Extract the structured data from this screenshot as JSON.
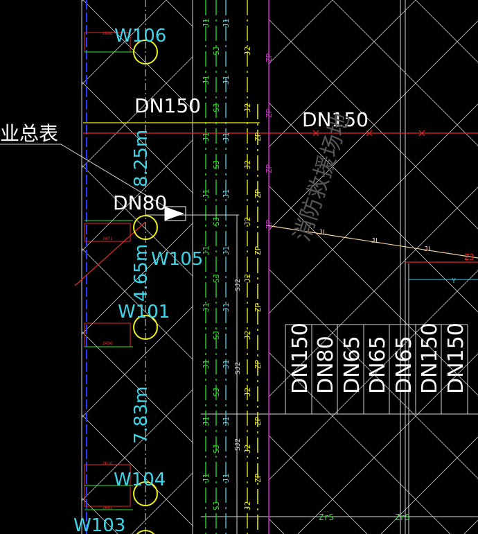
{
  "labels": {
    "meter_label": "业总表",
    "site_label": "消防救援场地",
    "dn150_top": "DN150",
    "dn150_main": "DN150",
    "dn80": "DN80",
    "dim_1": "8.25m",
    "dim_2": "4.65m",
    "dim_3": "7.83m",
    "well_w106": "W106",
    "well_w105": "W105",
    "well_w101": "W101",
    "well_w104": "W104",
    "well_w103": "W103",
    "zrs_1": "ZrS",
    "zrs_2": "ZrS",
    "z3": "Z3"
  },
  "pipe_codes": {
    "j1": "J1",
    "sj": "SJ",
    "j2": "J2",
    "zp": "ZP",
    "sj2": "SJ2",
    "jl": "JL",
    "x": "X",
    "y": "Y"
  },
  "pipe_table": [
    "DN150",
    "DN80",
    "DN65",
    "DN65",
    "DN65",
    "DN150",
    "DN150"
  ],
  "small_dims": [
    "2696",
    "2471",
    "2496",
    "2616",
    "2681"
  ],
  "colors": {
    "background": "#000000",
    "grid_white": "#d8d8d8",
    "pipe_green": "#2ee82e",
    "pipe_cyan": "#3fd5e8",
    "pipe_yellow": "#f2f21a",
    "pipe_magenta": "#d22ad2",
    "pipe_red": "#e82a2a",
    "wall_blue": "#2a3cff",
    "hatch_tan": "#f5d2a0"
  }
}
